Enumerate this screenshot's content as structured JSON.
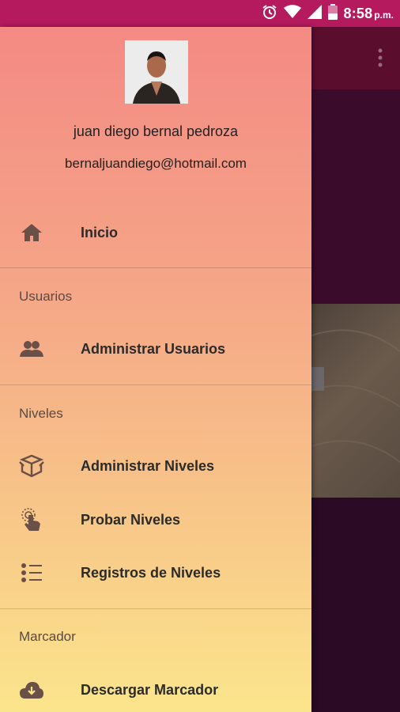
{
  "status_bar": {
    "time": "8:58",
    "ampm": "p.m.",
    "icons": [
      "alarm-icon",
      "wifi-icon",
      "signal-icon",
      "battery-icon"
    ]
  },
  "drawer": {
    "user": {
      "name": "juan diego bernal pedroza",
      "email": "bernaljuandiego@hotmail.com"
    },
    "home_item": {
      "label": "Inicio",
      "icon": "home-icon"
    },
    "sections": [
      {
        "header": "Usuarios",
        "items": [
          {
            "label": "Administrar Usuarios",
            "icon": "users-icon"
          }
        ]
      },
      {
        "header": "Niveles",
        "items": [
          {
            "label": "Administrar Niveles",
            "icon": "box-icon"
          },
          {
            "label": "Probar Niveles",
            "icon": "touch-icon"
          },
          {
            "label": "Registros de Niveles",
            "icon": "list-icon"
          }
        ]
      },
      {
        "header": "Marcador",
        "items": [
          {
            "label": "Descargar Marcador",
            "icon": "cloud-download-icon"
          }
        ]
      }
    ]
  },
  "colors": {
    "status_bar": "#b5195e",
    "drawer_top": "#f48a84",
    "drawer_bottom": "#fbe58c",
    "icon": "#6b5048"
  }
}
